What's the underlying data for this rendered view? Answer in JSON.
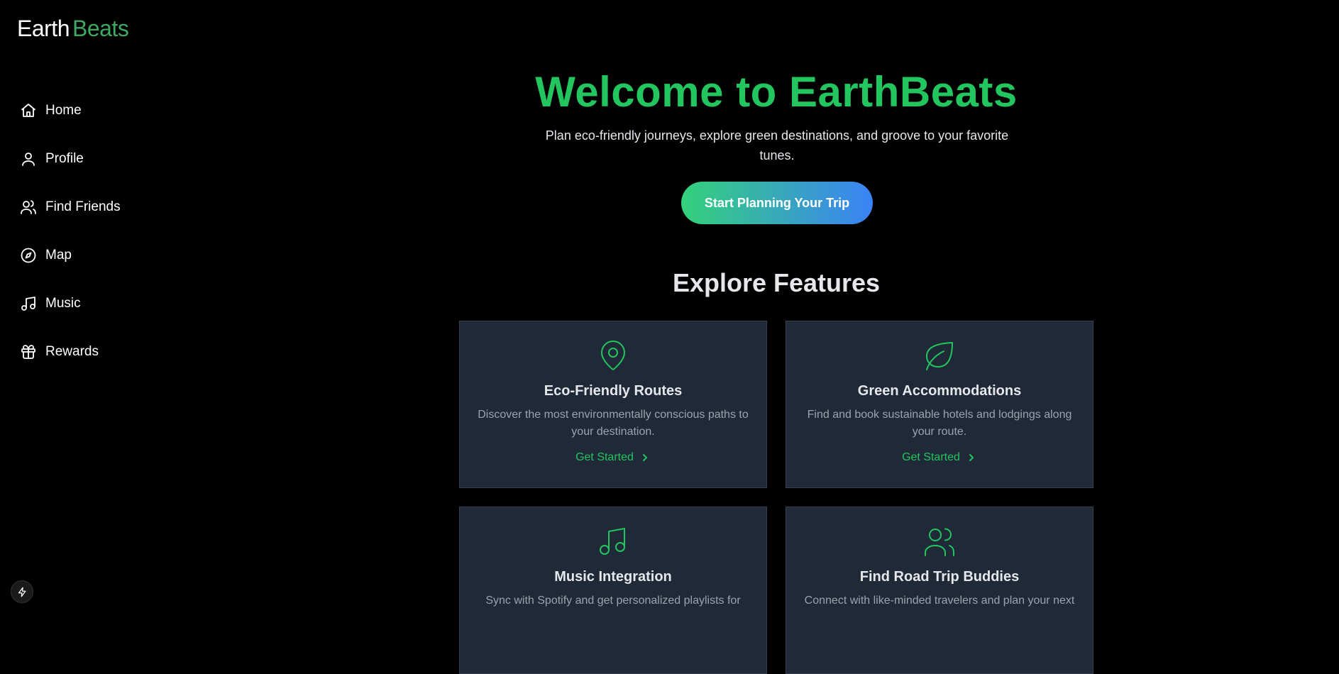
{
  "brand": {
    "part1": "Earth",
    "part2": "Beats"
  },
  "nav": [
    {
      "label": "Home",
      "icon": "home-icon"
    },
    {
      "label": "Profile",
      "icon": "user-icon"
    },
    {
      "label": "Find Friends",
      "icon": "users-icon"
    },
    {
      "label": "Map",
      "icon": "compass-icon"
    },
    {
      "label": "Music",
      "icon": "music-icon"
    },
    {
      "label": "Rewards",
      "icon": "gift-icon"
    }
  ],
  "hero": {
    "title": "Welcome to EarthBeats",
    "subtitle": "Plan eco-friendly journeys, explore green destinations, and groove to your favorite tunes.",
    "cta": "Start Planning Your Trip"
  },
  "features": {
    "title": "Explore Features",
    "cards": [
      {
        "icon": "map-pin-icon",
        "title": "Eco-Friendly Routes",
        "description": "Discover the most environmentally conscious paths to your destination.",
        "link": "Get Started"
      },
      {
        "icon": "leaf-icon",
        "title": "Green Accommodations",
        "description": "Find and book sustainable hotels and lodgings along your route.",
        "link": "Get Started"
      },
      {
        "icon": "music-icon",
        "title": "Music Integration",
        "description": "Sync with Spotify and get personalized playlists for",
        "link": ""
      },
      {
        "icon": "users-icon",
        "title": "Find Road Trip Buddies",
        "description": "Connect with like-minded travelers and plan your next",
        "link": ""
      }
    ]
  },
  "colors": {
    "accent": "#22c55e",
    "brand_green": "#3fa864",
    "card_bg": "#1f2937",
    "gradient_start": "#34d17a",
    "gradient_end": "#3b82f6"
  }
}
